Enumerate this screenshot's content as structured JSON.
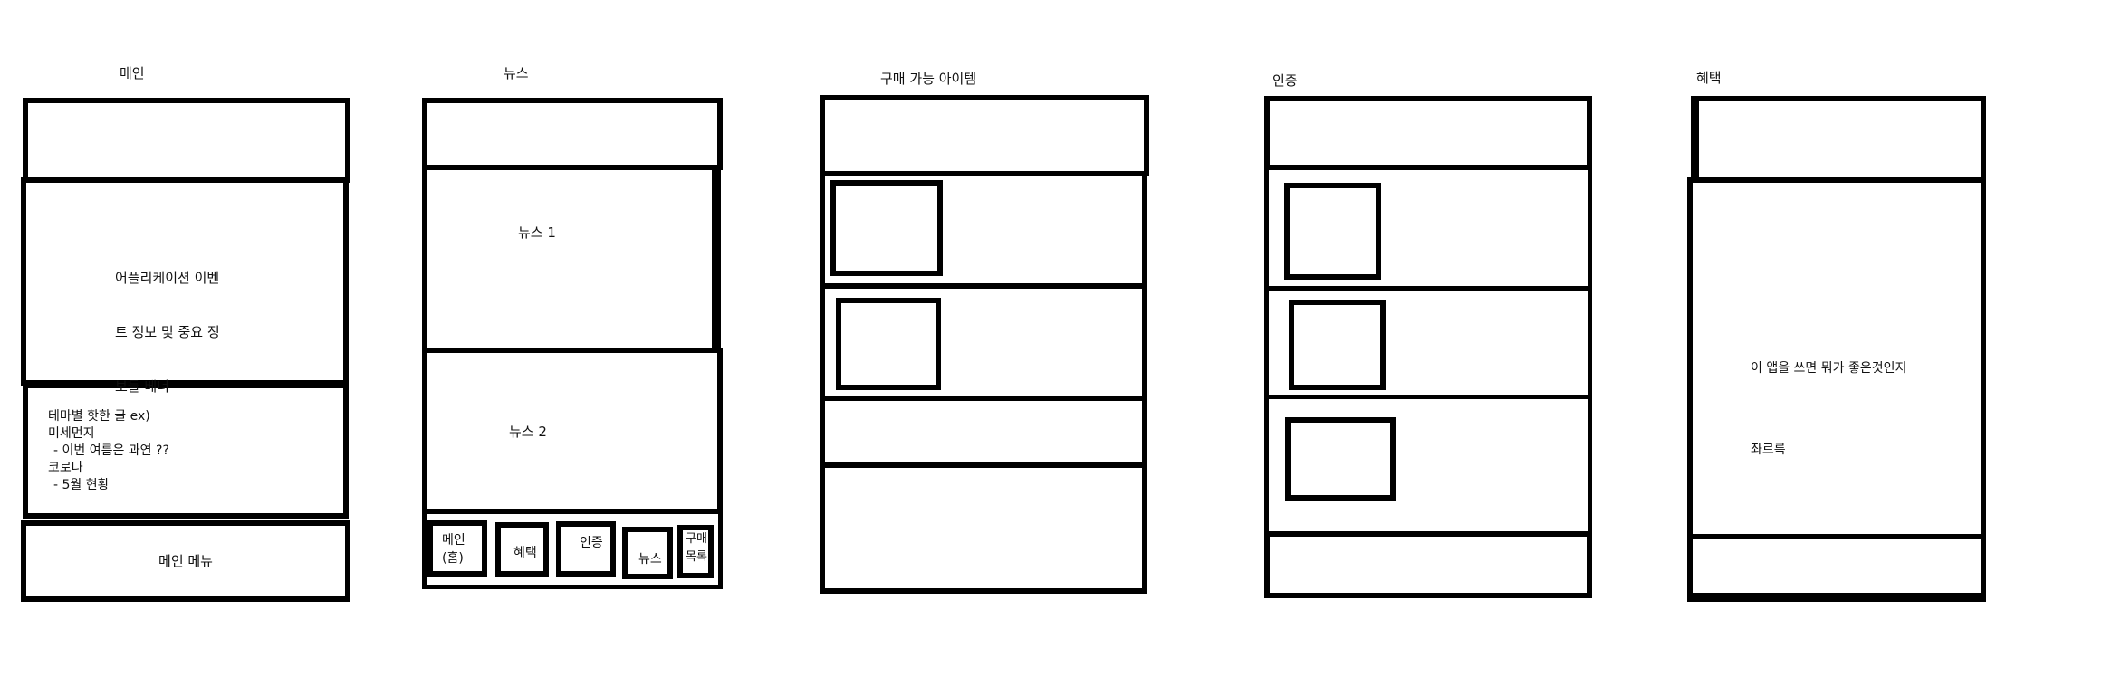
{
  "screens": {
    "main": {
      "title": "메인",
      "banner_lines": [
        "어플리케이션 이벤",
        "트 정보 및 중요 정",
        "보들 베너"
      ],
      "theme_lines": [
        "테마별 핫한 글 ex)",
        "미세먼지",
        " - 이번 여름은 과연 ??",
        "코로나",
        " - 5월 현황"
      ],
      "menu_label": "메인 메뉴"
    },
    "news": {
      "title": "뉴스",
      "items": [
        "뉴스 1",
        "뉴스 2"
      ],
      "nav": {
        "main_line1": "메인",
        "main_line2": "(홈)",
        "benefit": "혜택",
        "auth": "인증",
        "news": "뉴스",
        "purchase_line1": "구매",
        "purchase_line2": "목록"
      }
    },
    "purchase": {
      "title": "구매 가능 아이템"
    },
    "auth": {
      "title": "인증"
    },
    "benefit": {
      "title": "혜택",
      "body_lines": [
        "이 앱을 쓰면 뭐가 좋은것인지",
        "좌르륵"
      ]
    }
  }
}
